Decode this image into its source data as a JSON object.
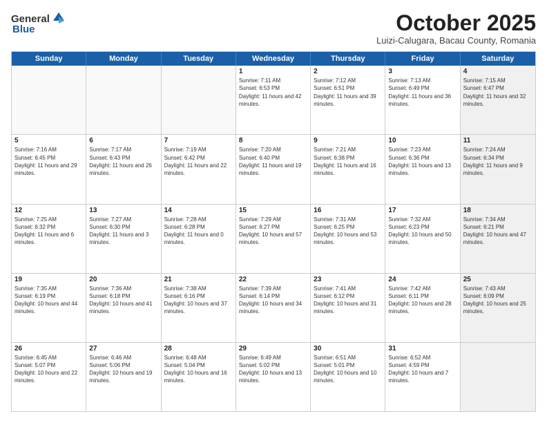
{
  "header": {
    "logo_general": "General",
    "logo_blue": "Blue",
    "month_title": "October 2025",
    "subtitle": "Luizi-Calugara, Bacau County, Romania"
  },
  "calendar": {
    "days_of_week": [
      "Sunday",
      "Monday",
      "Tuesday",
      "Wednesday",
      "Thursday",
      "Friday",
      "Saturday"
    ],
    "rows": [
      [
        {
          "day": "",
          "text": "",
          "empty": true
        },
        {
          "day": "",
          "text": "",
          "empty": true
        },
        {
          "day": "",
          "text": "",
          "empty": true
        },
        {
          "day": "1",
          "text": "Sunrise: 7:11 AM\nSunset: 6:53 PM\nDaylight: 11 hours and 42 minutes.",
          "empty": false
        },
        {
          "day": "2",
          "text": "Sunrise: 7:12 AM\nSunset: 6:51 PM\nDaylight: 11 hours and 39 minutes.",
          "empty": false
        },
        {
          "day": "3",
          "text": "Sunrise: 7:13 AM\nSunset: 6:49 PM\nDaylight: 11 hours and 36 minutes.",
          "empty": false
        },
        {
          "day": "4",
          "text": "Sunrise: 7:15 AM\nSunset: 6:47 PM\nDaylight: 11 hours and 32 minutes.",
          "empty": false,
          "shaded": true
        }
      ],
      [
        {
          "day": "5",
          "text": "Sunrise: 7:16 AM\nSunset: 6:45 PM\nDaylight: 11 hours and 29 minutes.",
          "empty": false
        },
        {
          "day": "6",
          "text": "Sunrise: 7:17 AM\nSunset: 6:43 PM\nDaylight: 11 hours and 26 minutes.",
          "empty": false
        },
        {
          "day": "7",
          "text": "Sunrise: 7:19 AM\nSunset: 6:42 PM\nDaylight: 11 hours and 22 minutes.",
          "empty": false
        },
        {
          "day": "8",
          "text": "Sunrise: 7:20 AM\nSunset: 6:40 PM\nDaylight: 11 hours and 19 minutes.",
          "empty": false
        },
        {
          "day": "9",
          "text": "Sunrise: 7:21 AM\nSunset: 6:38 PM\nDaylight: 11 hours and 16 minutes.",
          "empty": false
        },
        {
          "day": "10",
          "text": "Sunrise: 7:23 AM\nSunset: 6:36 PM\nDaylight: 11 hours and 13 minutes.",
          "empty": false
        },
        {
          "day": "11",
          "text": "Sunrise: 7:24 AM\nSunset: 6:34 PM\nDaylight: 11 hours and 9 minutes.",
          "empty": false,
          "shaded": true
        }
      ],
      [
        {
          "day": "12",
          "text": "Sunrise: 7:25 AM\nSunset: 6:32 PM\nDaylight: 11 hours and 6 minutes.",
          "empty": false
        },
        {
          "day": "13",
          "text": "Sunrise: 7:27 AM\nSunset: 6:30 PM\nDaylight: 11 hours and 3 minutes.",
          "empty": false
        },
        {
          "day": "14",
          "text": "Sunrise: 7:28 AM\nSunset: 6:28 PM\nDaylight: 11 hours and 0 minutes.",
          "empty": false
        },
        {
          "day": "15",
          "text": "Sunrise: 7:29 AM\nSunset: 6:27 PM\nDaylight: 10 hours and 57 minutes.",
          "empty": false
        },
        {
          "day": "16",
          "text": "Sunrise: 7:31 AM\nSunset: 6:25 PM\nDaylight: 10 hours and 53 minutes.",
          "empty": false
        },
        {
          "day": "17",
          "text": "Sunrise: 7:32 AM\nSunset: 6:23 PM\nDaylight: 10 hours and 50 minutes.",
          "empty": false
        },
        {
          "day": "18",
          "text": "Sunrise: 7:34 AM\nSunset: 6:21 PM\nDaylight: 10 hours and 47 minutes.",
          "empty": false,
          "shaded": true
        }
      ],
      [
        {
          "day": "19",
          "text": "Sunrise: 7:35 AM\nSunset: 6:19 PM\nDaylight: 10 hours and 44 minutes.",
          "empty": false
        },
        {
          "day": "20",
          "text": "Sunrise: 7:36 AM\nSunset: 6:18 PM\nDaylight: 10 hours and 41 minutes.",
          "empty": false
        },
        {
          "day": "21",
          "text": "Sunrise: 7:38 AM\nSunset: 6:16 PM\nDaylight: 10 hours and 37 minutes.",
          "empty": false
        },
        {
          "day": "22",
          "text": "Sunrise: 7:39 AM\nSunset: 6:14 PM\nDaylight: 10 hours and 34 minutes.",
          "empty": false
        },
        {
          "day": "23",
          "text": "Sunrise: 7:41 AM\nSunset: 6:12 PM\nDaylight: 10 hours and 31 minutes.",
          "empty": false
        },
        {
          "day": "24",
          "text": "Sunrise: 7:42 AM\nSunset: 6:11 PM\nDaylight: 10 hours and 28 minutes.",
          "empty": false
        },
        {
          "day": "25",
          "text": "Sunrise: 7:43 AM\nSunset: 6:09 PM\nDaylight: 10 hours and 25 minutes.",
          "empty": false,
          "shaded": true
        }
      ],
      [
        {
          "day": "26",
          "text": "Sunrise: 6:45 AM\nSunset: 5:07 PM\nDaylight: 10 hours and 22 minutes.",
          "empty": false
        },
        {
          "day": "27",
          "text": "Sunrise: 6:46 AM\nSunset: 5:06 PM\nDaylight: 10 hours and 19 minutes.",
          "empty": false
        },
        {
          "day": "28",
          "text": "Sunrise: 6:48 AM\nSunset: 5:04 PM\nDaylight: 10 hours and 16 minutes.",
          "empty": false
        },
        {
          "day": "29",
          "text": "Sunrise: 6:49 AM\nSunset: 5:02 PM\nDaylight: 10 hours and 13 minutes.",
          "empty": false
        },
        {
          "day": "30",
          "text": "Sunrise: 6:51 AM\nSunset: 5:01 PM\nDaylight: 10 hours and 10 minutes.",
          "empty": false
        },
        {
          "day": "31",
          "text": "Sunrise: 6:52 AM\nSunset: 4:59 PM\nDaylight: 10 hours and 7 minutes.",
          "empty": false
        },
        {
          "day": "",
          "text": "",
          "empty": true,
          "shaded": true
        }
      ]
    ]
  }
}
